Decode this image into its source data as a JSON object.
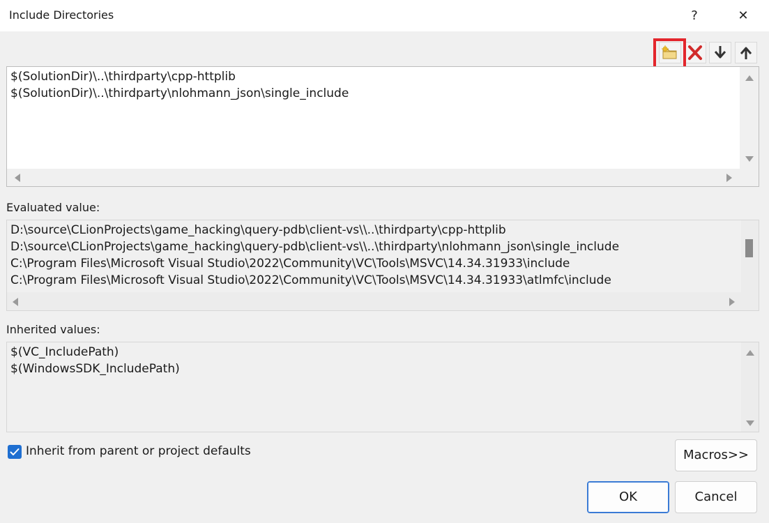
{
  "window": {
    "title": "Include Directories",
    "help_glyph": "?",
    "close_glyph": "✕"
  },
  "toolbar": {
    "new_line_icon": "new-folder-icon",
    "delete_icon": "delete-x-icon",
    "move_down_icon": "arrow-down-icon",
    "move_up_icon": "arrow-up-icon",
    "highlight_color": "#e3262c"
  },
  "directories": [
    "$(SolutionDir)\\..\\thirdparty\\cpp-httplib",
    "$(SolutionDir)\\..\\thirdparty\\nlohmann_json\\single_include"
  ],
  "evaluated": {
    "label": "Evaluated value:",
    "lines": [
      "D:\\source\\CLionProjects\\game_hacking\\query-pdb\\client-vs\\\\..\\thirdparty\\cpp-httplib",
      "D:\\source\\CLionProjects\\game_hacking\\query-pdb\\client-vs\\\\..\\thirdparty\\nlohmann_json\\single_include",
      "C:\\Program Files\\Microsoft Visual Studio\\2022\\Community\\VC\\Tools\\MSVC\\14.34.31933\\include",
      "C:\\Program Files\\Microsoft Visual Studio\\2022\\Community\\VC\\Tools\\MSVC\\14.34.31933\\atlmfc\\include"
    ]
  },
  "inherited": {
    "label": "Inherited values:",
    "lines": [
      "$(VC_IncludePath)",
      "$(WindowsSDK_IncludePath)"
    ]
  },
  "inherit_checkbox": {
    "label": "Inherit from parent or project defaults",
    "checked": true,
    "accent": "#1f6fd1"
  },
  "buttons": {
    "macros": "Macros>>",
    "ok": "OK",
    "cancel": "Cancel"
  }
}
